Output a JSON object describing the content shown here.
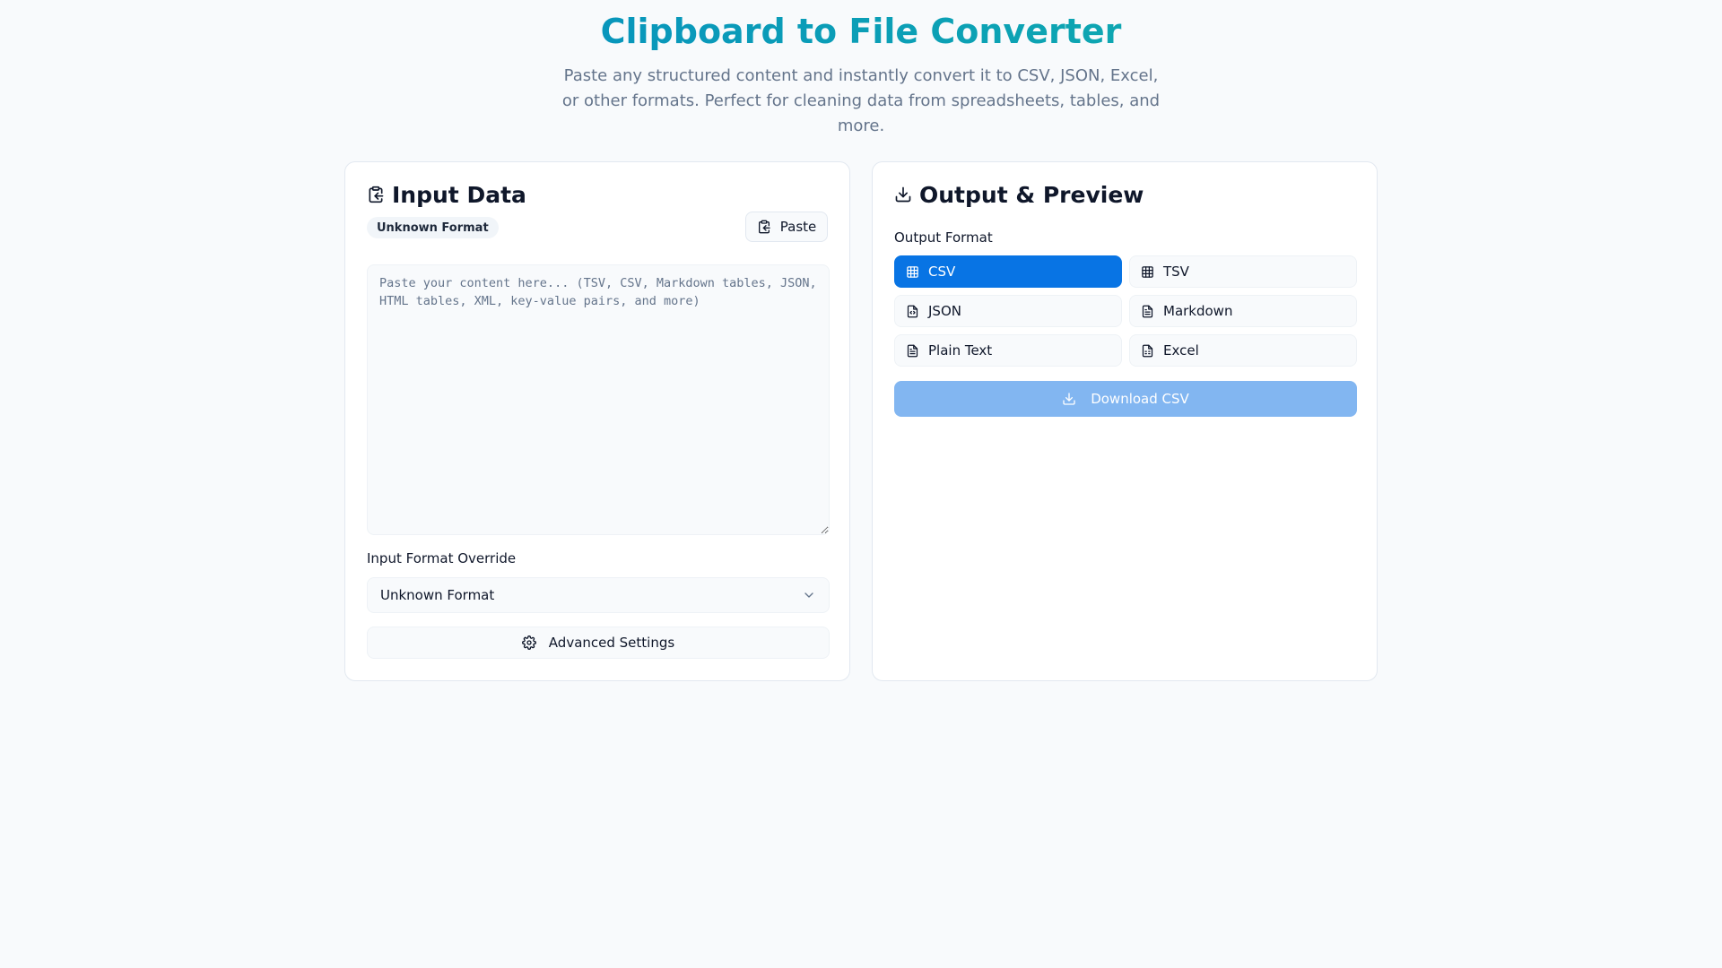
{
  "header": {
    "title": "Clipboard to File Converter",
    "subtitle": "Paste any structured content and instantly convert it to CSV, JSON, Excel, or other formats. Perfect for cleaning data from spreadsheets, tables, and more."
  },
  "input_panel": {
    "title": "Input Data",
    "title_icon": "clipboard-icon",
    "detected_format": "Unknown Format",
    "paste_label": "Paste",
    "paste_icon": "clipboard-icon",
    "textarea_value": "",
    "textarea_placeholder": "Paste your content here... (TSV, CSV, Markdown tables, JSON, HTML tables, XML, key-value pairs, and more)",
    "override_label": "Input Format Override",
    "override_value": "Unknown Format",
    "override_icon": "chevron-down-icon",
    "advanced_label": "Advanced Settings",
    "advanced_icon": "gear-icon"
  },
  "output_panel": {
    "title": "Output & Preview",
    "title_icon": "download-icon",
    "format_label": "Output Format",
    "formats": [
      {
        "label": "CSV",
        "icon": "table-icon",
        "active": true
      },
      {
        "label": "TSV",
        "icon": "table-icon",
        "active": false
      },
      {
        "label": "JSON",
        "icon": "file-code-icon",
        "active": false
      },
      {
        "label": "Markdown",
        "icon": "file-text-icon",
        "active": false
      },
      {
        "label": "Plain Text",
        "icon": "file-text-icon",
        "active": false
      },
      {
        "label": "Excel",
        "icon": "file-spreadsheet-icon",
        "active": false
      }
    ],
    "download_label": "Download CSV",
    "download_icon": "download-icon"
  },
  "colors": {
    "accent": "#0874e4",
    "accent_disabled": "#82b6f1",
    "title_gradient_start": "#0284c7",
    "title_gradient_end": "#14b8a6"
  }
}
